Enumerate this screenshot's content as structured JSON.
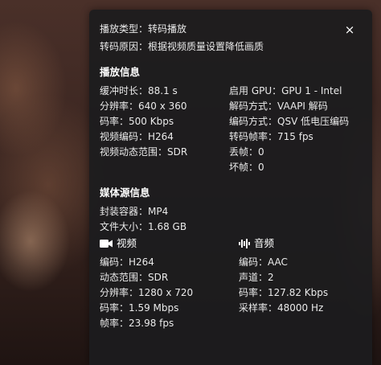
{
  "top": {
    "play_type": "播放类型：转码播放",
    "transcode_reason": "转码原因：根据视频质量设置降低画质",
    "close_symbol": "×"
  },
  "playback": {
    "title": "播放信息",
    "left": [
      "缓冲时长：88.1 s",
      "分辨率：640 x 360",
      "码率：500 Kbps",
      "视频编码：H264",
      "视频动态范围：SDR"
    ],
    "right": [
      "启用 GPU：GPU 1 - Intel",
      "解码方式：VAAPI 解码",
      "编码方式：QSV 低电压编码",
      "转码帧率：715 fps",
      "丢帧：0",
      "坏帧：0"
    ]
  },
  "media": {
    "title": "媒体源信息",
    "container": "封装容器：MP4",
    "size": "文件大小：1.68 GB",
    "video": {
      "title": "视频",
      "icon": "video-camera-icon",
      "lines": [
        "编码：H264",
        "动态范围：SDR",
        "分辨率：1280 x 720",
        "码率：1.59 Mbps",
        "帧率：23.98 fps"
      ]
    },
    "audio": {
      "title": "音频",
      "icon": "audio-waveform-icon",
      "lines": [
        "编码：AAC",
        "声道：2",
        "码率：127.82 Kbps",
        "采样率：48000 Hz"
      ]
    }
  }
}
